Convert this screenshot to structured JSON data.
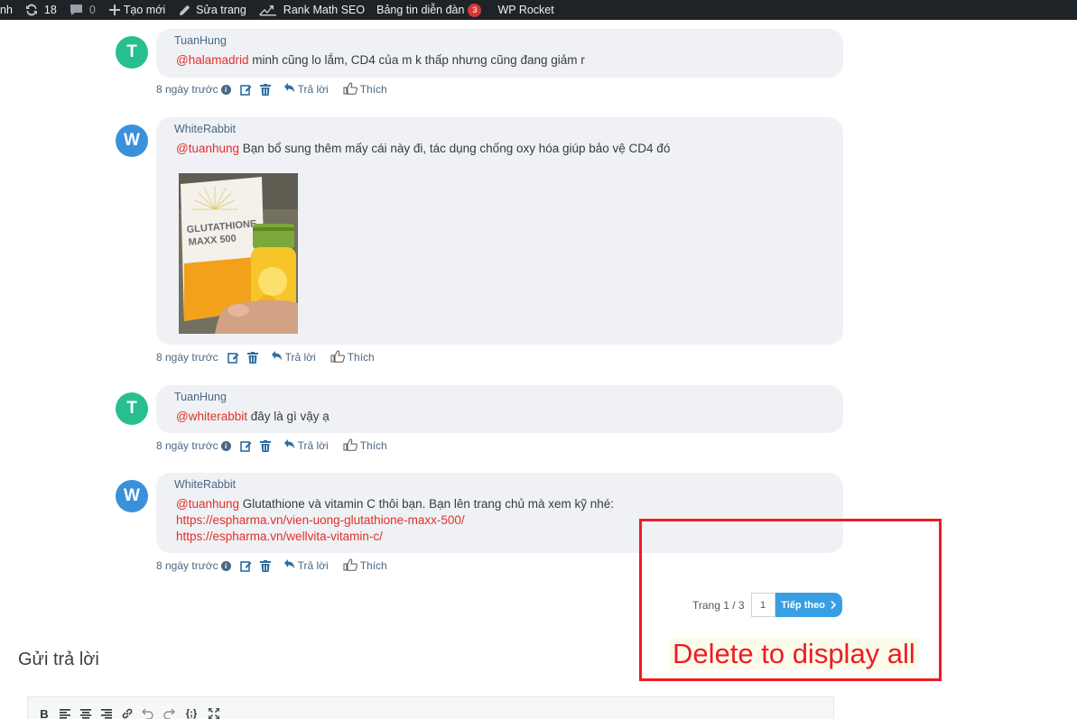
{
  "admin_bar": {
    "site_fragment": "nh",
    "updates_count": "18",
    "comments_count": "0",
    "new_label": "Tạo mới",
    "edit_label": "Sửa trang",
    "seo_label": "Rank Math SEO",
    "forum_label": "Bảng tin diễn đàn",
    "forum_badge": "3",
    "rocket_label": "WP Rocket"
  },
  "comments": [
    {
      "author": "TuanHung",
      "initial": "T",
      "mention": "@halamadrid",
      "text": " minh cũng lo lắm, CD4 của m k thấp nhưng cũng đang giảm r",
      "time": "8 ngày trước"
    },
    {
      "author": "WhiteRabbit",
      "initial": "W",
      "mention": "@tuanhung",
      "text": " Bạn bổ sung thêm mấy cái này đi, tác dụng chống oxy hóa giúp bảo vệ CD4 đó",
      "image_product_line1": "GLUTATHIONE",
      "image_product_line2": "MAXX 500",
      "time": "8 ngày trước"
    },
    {
      "author": "TuanHung",
      "initial": "T",
      "mention": "@whiterabbit",
      "text": " đây là gì vậy ạ",
      "time": "8 ngày trước"
    },
    {
      "author": "WhiteRabbit",
      "initial": "W",
      "mention": "@tuanhung",
      "text": " Glutathione và vitamin C thôi bạn. Bạn lên trang chủ mà xem kỹ nhé:",
      "link1": "https://espharma.vn/vien-uong-glutathione-maxx-500/",
      "link2": "https://espharma.vn/wellvita-vitamin-c/",
      "time": "8 ngày trước"
    }
  ],
  "actions": {
    "reply_label": "Trả lời",
    "like_label": "Thích"
  },
  "pagination": {
    "label": "Trang 1 / 3",
    "current_page": "1",
    "next_label": "Tiếp theo"
  },
  "annotation": {
    "label": "Delete to display all",
    "color": "#ee1c24"
  },
  "reply_section": {
    "title": "Gửi trả lời"
  },
  "editor_toolbar": [
    "bold",
    "align-left",
    "align-center",
    "align-right",
    "link",
    "undo",
    "redo",
    "code-block",
    "fullscreen"
  ],
  "colors": {
    "mention": "#e0302a",
    "avatar_t": "#27bf8f",
    "avatar_w": "#3a91db",
    "bubble": "#eff1f5",
    "meta": "#4b6784",
    "next_button": "#3a9ee2",
    "admin_bar": "#1d2327"
  }
}
